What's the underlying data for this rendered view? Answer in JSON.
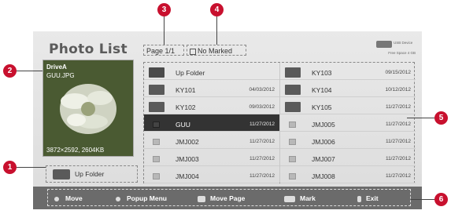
{
  "screen": {
    "title": "Photo List",
    "page_indicator": "Page 1/1",
    "marked_indicator": "No Marked",
    "usb": {
      "label": "USB Device",
      "free": "Free Space 4 GB"
    }
  },
  "preview": {
    "drive": "DriveA",
    "file": "GUU.JPG",
    "resolution": "3872×2592, 2604KB"
  },
  "up_folder_label": "Up Folder",
  "grid": {
    "left": [
      {
        "name": "Up Folder",
        "date": "",
        "kind": "up"
      },
      {
        "name": "KY101",
        "date": "04/03/2012",
        "kind": "folder"
      },
      {
        "name": "KY102",
        "date": "09/03/2012",
        "kind": "folder"
      },
      {
        "name": "GUU",
        "date": "11/27/2012",
        "kind": "photo",
        "selected": true
      },
      {
        "name": "JMJ002",
        "date": "11/27/2012",
        "kind": "photo"
      },
      {
        "name": "JMJ003",
        "date": "11/27/2012",
        "kind": "photo"
      },
      {
        "name": "JMJ004",
        "date": "11/27/2012",
        "kind": "photo"
      }
    ],
    "right": [
      {
        "name": "KY103",
        "date": "09/15/2012",
        "kind": "folder"
      },
      {
        "name": "KY104",
        "date": "10/12/2012",
        "kind": "folder"
      },
      {
        "name": "KY105",
        "date": "11/27/2012",
        "kind": "folder"
      },
      {
        "name": "JMJ005",
        "date": "11/27/2012",
        "kind": "photo"
      },
      {
        "name": "JMJ006",
        "date": "11/27/2012",
        "kind": "photo"
      },
      {
        "name": "JMJ007",
        "date": "11/27/2012",
        "kind": "photo"
      },
      {
        "name": "JMJ008",
        "date": "11/27/2012",
        "kind": "photo"
      }
    ]
  },
  "bottombar": {
    "move": "Move",
    "popup": "Popup Menu",
    "movepage": "Move Page",
    "mark": "Mark",
    "exit": "Exit"
  },
  "callouts": [
    "1",
    "2",
    "3",
    "4",
    "5",
    "6"
  ]
}
